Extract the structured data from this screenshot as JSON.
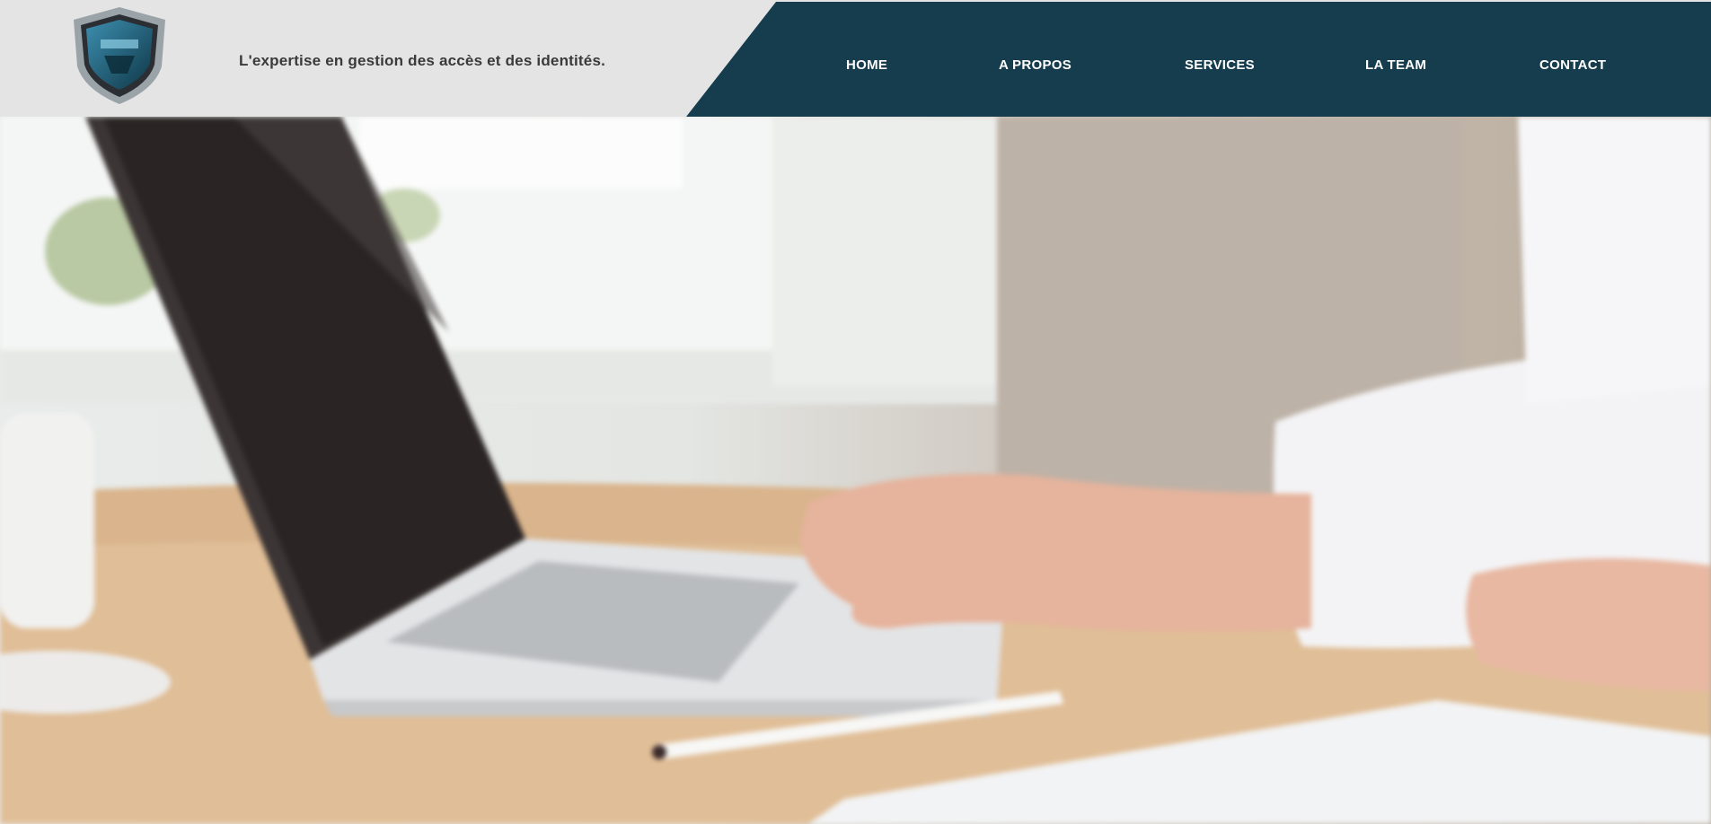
{
  "header": {
    "tagline": "L'expertise en gestion des accès et des identités.",
    "logo_icon": "shield-logo"
  },
  "nav": {
    "items": [
      {
        "label": "HOME"
      },
      {
        "label": "A PROPOS"
      },
      {
        "label": "SERVICES"
      },
      {
        "label": "LA TEAM"
      },
      {
        "label": "CONTACT"
      }
    ]
  },
  "hero": {
    "image": "person-typing-on-laptop-photo"
  },
  "colors": {
    "header_bg": "#e4e4e4",
    "nav_bg": "#163d4d",
    "nav_text": "#ffffff",
    "tagline_text": "#3a3a3a"
  }
}
